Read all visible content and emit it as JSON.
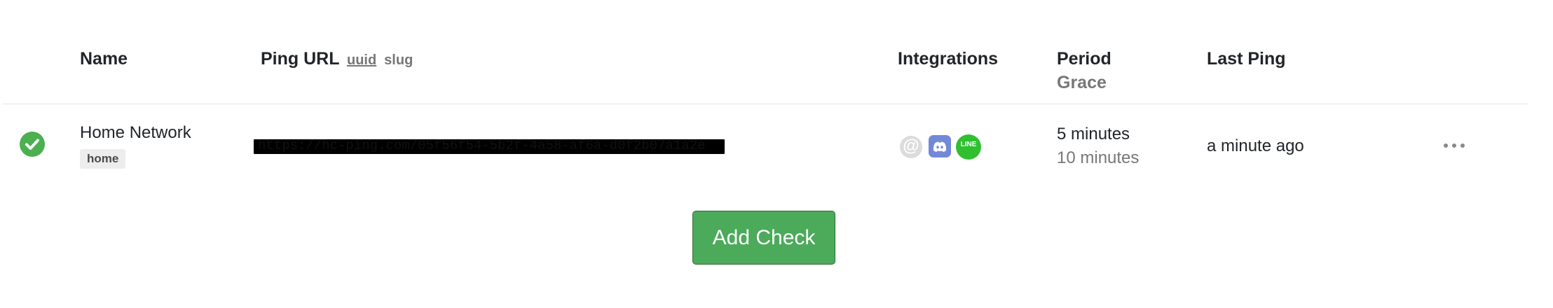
{
  "table": {
    "headers": {
      "name": "Name",
      "ping_url": "Ping URL",
      "url_modes": [
        "uuid",
        "slug"
      ],
      "integrations": "Integrations",
      "period": "Period",
      "grace": "Grace",
      "last_ping": "Last Ping"
    },
    "rows": [
      {
        "status": "up",
        "name": "Home Network",
        "tag": "home",
        "ping_url": "https://hc-ping.com/05f56f54-5b2f-4a58-af6a-d0f2b07a1a2e",
        "integrations": [
          "email-icon",
          "discord-icon",
          "line-icon"
        ],
        "period": "5 minutes",
        "grace": "10 minutes",
        "last_ping": "a minute ago"
      }
    ]
  },
  "integrations_labels": {
    "line": "LINE",
    "email": "@"
  },
  "add_check_label": "Add Check",
  "colors": {
    "status_up": "#4caf50",
    "button": "#4caa5b",
    "muted": "#777777"
  }
}
